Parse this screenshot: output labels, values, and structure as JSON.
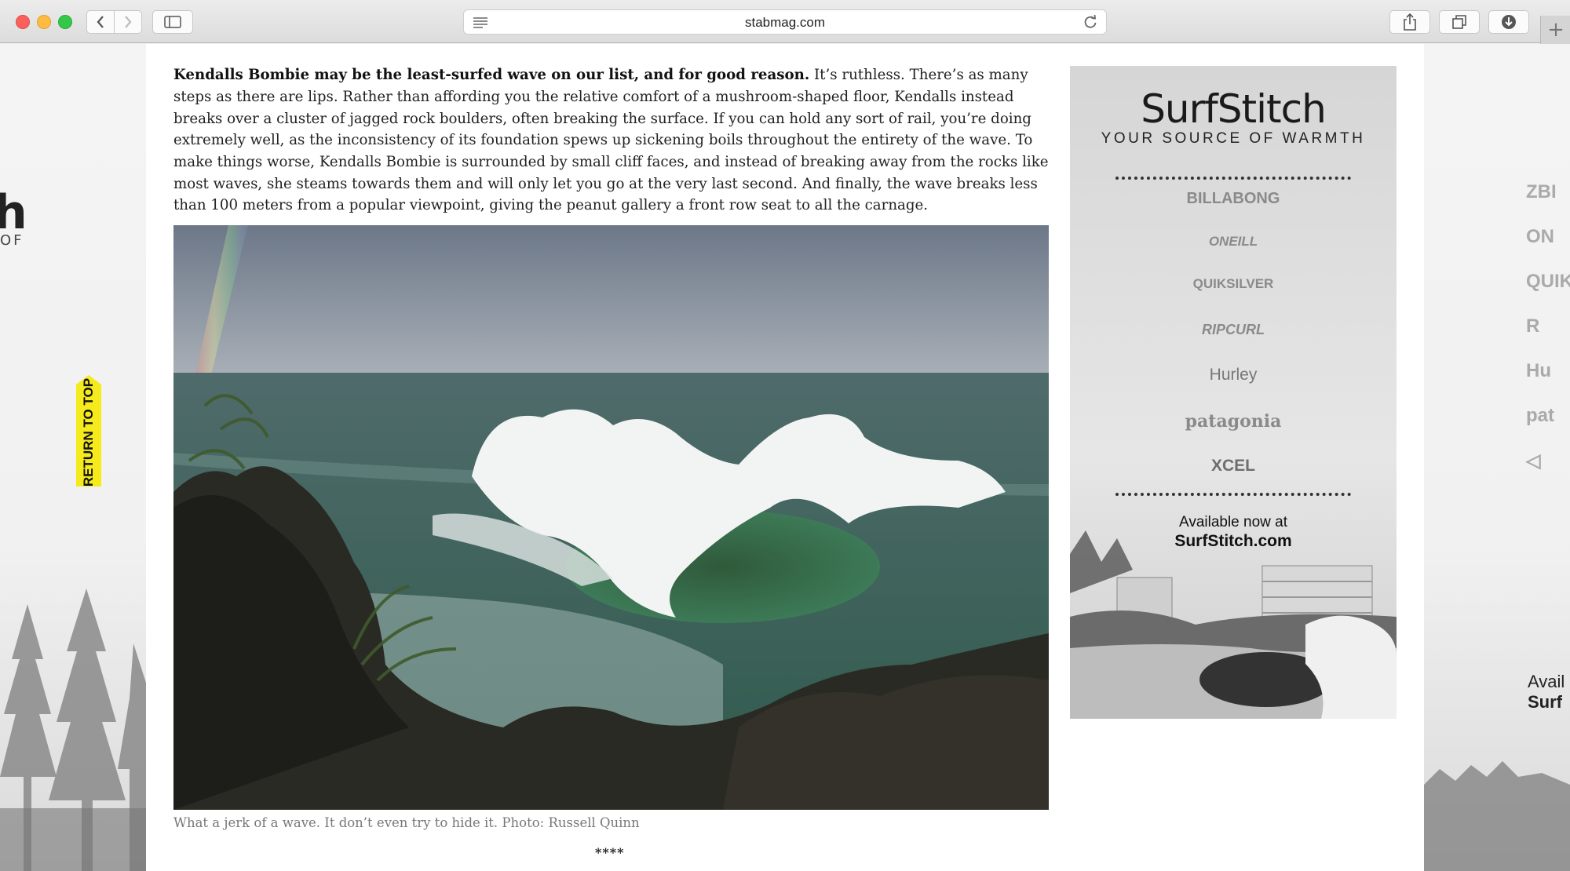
{
  "browser": {
    "url": "stabmag.com"
  },
  "background": {
    "left_logo": "h",
    "left_sub": "OF",
    "right_logos": [
      "ZBI",
      "ON",
      "QUIK",
      "R",
      "Hu",
      "pat",
      "◁"
    ],
    "right_avail_line1": "Avail",
    "right_avail_line2": "Surf"
  },
  "return_to_top": "RETURN TO TOP",
  "article": {
    "lead_bold": "Kendalls Bombie may be the least-surfed wave on our list, and for good reason.",
    "body": " It’s ruthless. There’s as many steps as there are lips. Rather than affording you the relative comfort of a mushroom-shaped floor, Kendalls instead breaks over a cluster of jagged rock boulders, often breaking the surface. If you can hold any sort of rail, you’re doing extremely well, as the inconsistency of its foundation spews up sickening boils throughout the entirety of the wave. To make things worse, Kendalls Bombie is surrounded by small cliff faces, and instead of breaking away from the rocks like most waves, she steams towards them and will only let you go at the very last second. And finally, the wave breaks less than 100 meters from a popular viewpoint, giving the peanut gallery a front row seat to all the carnage.",
    "caption": "What a jerk of a wave. It don’t even try to hide it. Photo: Russell Quinn",
    "separator": "****"
  },
  "ad": {
    "logo": "SurfStitch",
    "tagline": "YOUR SOURCE OF WARMTH",
    "brands": [
      "BILLABONG",
      "ONEILL",
      "QUIKSILVER",
      "RIPCURL",
      "Hurley",
      "patagonia",
      "XCEL"
    ],
    "available": "Available now at",
    "site": "SurfStitch.com"
  }
}
